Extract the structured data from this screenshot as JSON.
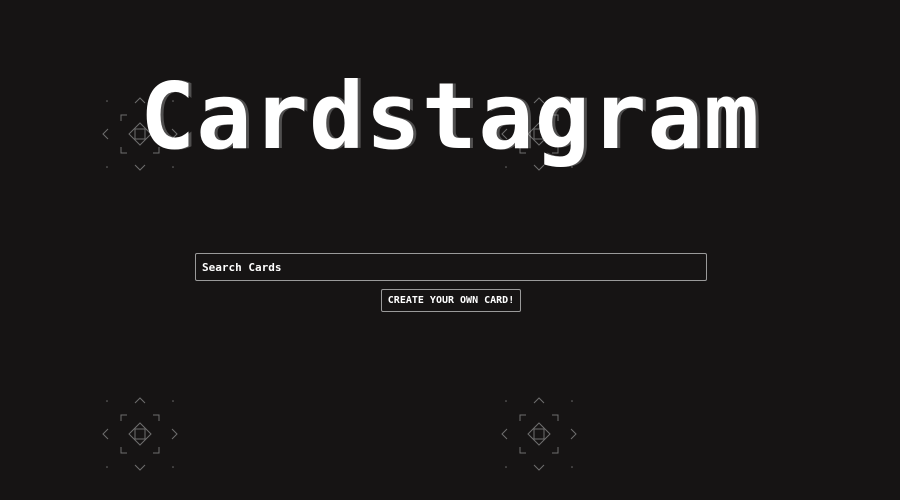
{
  "header": {
    "title": "Cardstagram"
  },
  "search": {
    "placeholder": "Search Cards",
    "value": ""
  },
  "actions": {
    "create_label": "CREATE YOUR OWN CARD!"
  },
  "decor": {
    "pattern_icon": "diamond-grid-icon",
    "pattern_color": "#6e6e6e"
  },
  "colors": {
    "background": "#161414",
    "text": "#ffffff",
    "border": "#9a9a9a"
  }
}
